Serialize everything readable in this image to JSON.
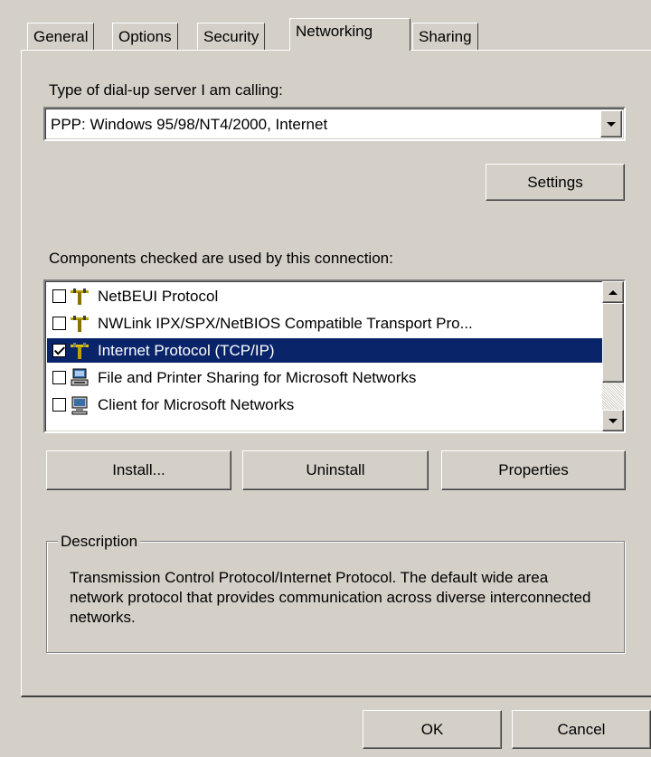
{
  "tabs": [
    {
      "label": "General"
    },
    {
      "label": "Options"
    },
    {
      "label": "Security"
    },
    {
      "label": "Networking"
    },
    {
      "label": "Sharing"
    }
  ],
  "active_tab": "Networking",
  "server_type": {
    "label": "Type of dial-up server I am calling:",
    "selected_value": "PPP: Windows 95/98/NT4/2000, Internet"
  },
  "settings_button": "Settings",
  "components": {
    "label": "Components checked are used by this connection:",
    "items": [
      {
        "label": "NetBEUI Protocol",
        "checked": false,
        "icon": "protocol-icon"
      },
      {
        "label": "NWLink IPX/SPX/NetBIOS Compatible Transport Pro...",
        "checked": false,
        "icon": "protocol-icon"
      },
      {
        "label": "Internet Protocol (TCP/IP)",
        "checked": true,
        "icon": "protocol-icon",
        "selected": true
      },
      {
        "label": "File and Printer Sharing for Microsoft Networks",
        "checked": false,
        "icon": "service-icon"
      },
      {
        "label": "Client for Microsoft Networks",
        "checked": false,
        "icon": "client-icon"
      }
    ]
  },
  "buttons": {
    "install": "Install...",
    "uninstall": "Uninstall",
    "properties": "Properties",
    "ok": "OK",
    "cancel": "Cancel"
  },
  "description": {
    "title": "Description",
    "text": "Transmission Control Protocol/Internet Protocol. The default wide area network protocol that provides communication across diverse interconnected networks."
  },
  "colors": {
    "face": "#d4d0c8",
    "selection": "#0a246a",
    "window": "#ffffff"
  }
}
